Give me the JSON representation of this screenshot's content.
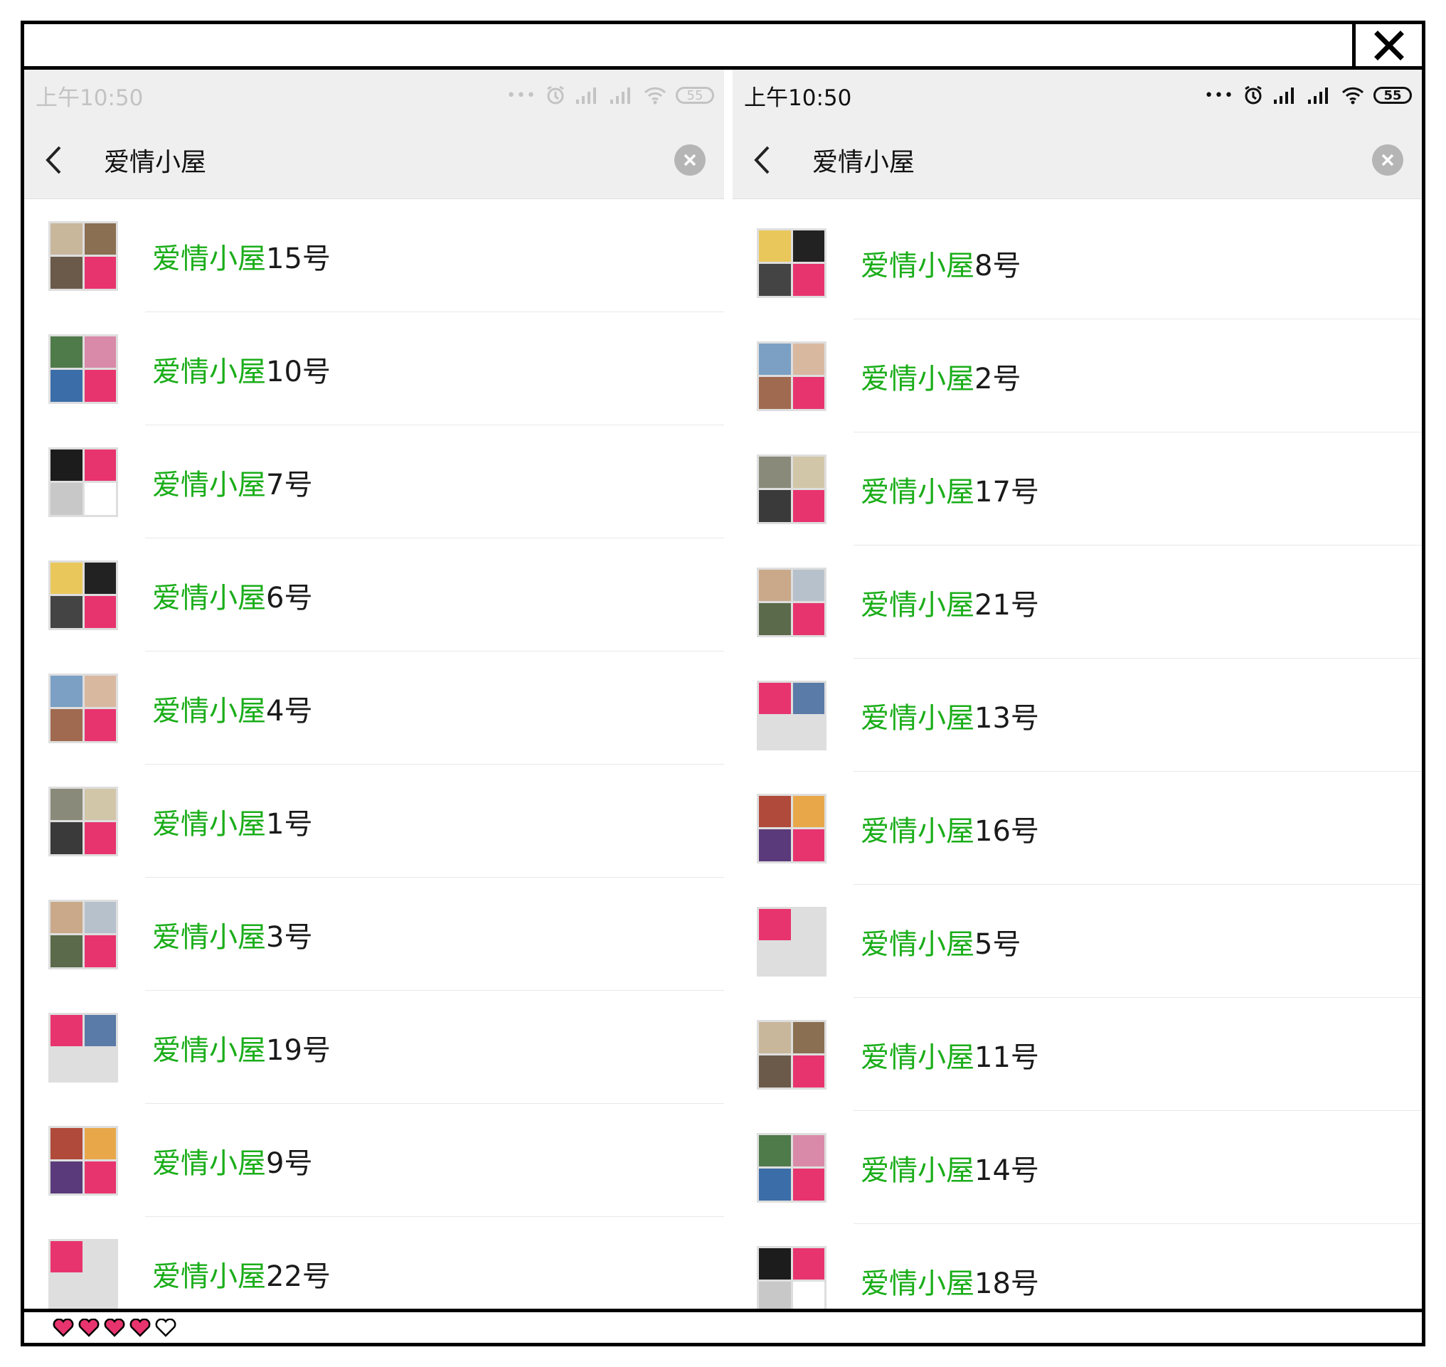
{
  "status_bar": {
    "time": "上午10:50",
    "battery": "55",
    "dots": "•••"
  },
  "search": {
    "query": "爱情小屋"
  },
  "result_prefix": "爱情小屋",
  "colors": {
    "accent_green": "#1aad19",
    "heart_pink": "#e8346e",
    "bar_gray": "#efefef"
  },
  "left_results": [
    {
      "number": "15号"
    },
    {
      "number": "10号"
    },
    {
      "number": "7号"
    },
    {
      "number": "6号"
    },
    {
      "number": "4号"
    },
    {
      "number": "1号"
    },
    {
      "number": "3号"
    },
    {
      "number": "19号"
    },
    {
      "number": "9号"
    },
    {
      "number": "22号"
    }
  ],
  "right_results": [
    {
      "number": "8号"
    },
    {
      "number": "2号"
    },
    {
      "number": "17号"
    },
    {
      "number": "21号"
    },
    {
      "number": "13号"
    },
    {
      "number": "16号"
    },
    {
      "number": "5号"
    },
    {
      "number": "11号"
    },
    {
      "number": "14号"
    },
    {
      "number": "18号"
    }
  ],
  "hearts": {
    "filled": 4,
    "total": 5
  },
  "icons": {
    "window_close": "close-x-icon",
    "back": "chevron-left-icon",
    "clear": "clear-circle-icon",
    "alarm": "alarm-icon",
    "signal": "signal-icon",
    "wifi": "wifi-icon",
    "battery": "battery-icon",
    "heart": "heart-icon"
  }
}
